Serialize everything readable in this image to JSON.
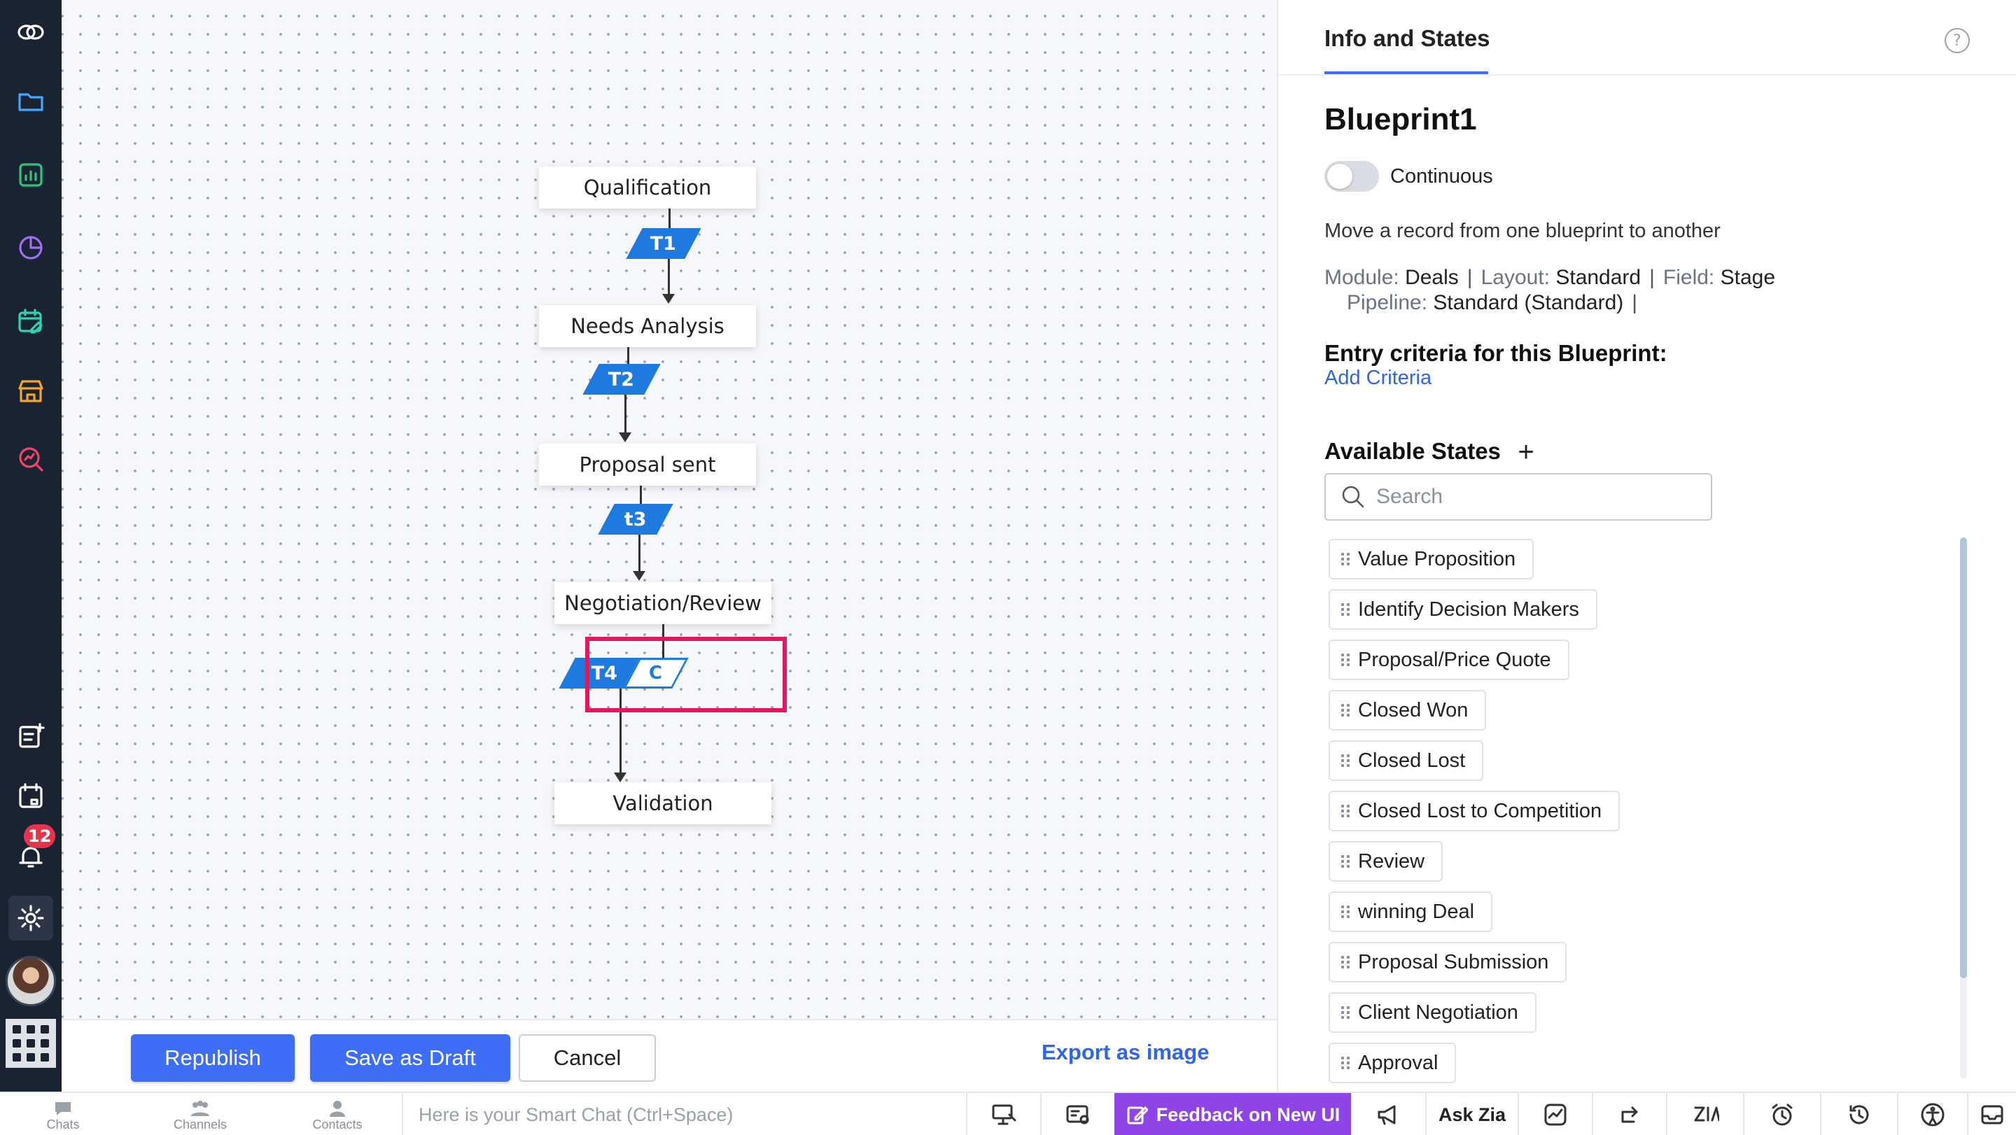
{
  "rail": {
    "icons": [
      "zoho-logo-icon",
      "folder-icon",
      "analytics-icon",
      "pie-chart-icon",
      "calendar-edit-icon",
      "marketplace-icon",
      "search-zoom-icon",
      "add-note-icon",
      "calendar-icon",
      "bell-icon",
      "gear-icon",
      "avatar",
      "apps-grid-icon"
    ],
    "notification_count": "12"
  },
  "canvas": {
    "states": [
      "Qualification",
      "Needs Analysis",
      "Proposal sent",
      "Negotiation/Review",
      "Validation"
    ],
    "transitions": [
      "T1",
      "T2",
      "t3",
      "T4"
    ],
    "condition_badge": "C",
    "colors": {
      "transition": "#1f7ae0",
      "highlight": "#e3175b"
    }
  },
  "actions": {
    "republish": "Republish",
    "save_draft": "Save as Draft",
    "cancel": "Cancel",
    "export": "Export as image"
  },
  "panel": {
    "tab": "Info and States",
    "help": "?",
    "title": "Blueprint1",
    "toggle_label": "Continuous",
    "description": "Move a record from one blueprint to another",
    "module_key": "Module:",
    "module_val": "Deals",
    "layout_key": "Layout:",
    "layout_val": "Standard",
    "field_key": "Field:",
    "field_val": "Stage",
    "pipeline_key": "Pipeline:",
    "pipeline_val": "Standard (Standard)",
    "separator": "|",
    "entry_title": "Entry criteria for this Blueprint:",
    "add_criteria": "Add Criteria",
    "available_title": "Available States",
    "add_state": "+",
    "search_placeholder": "Search",
    "available_states": [
      "Value Proposition",
      "Identify Decision Makers",
      "Proposal/Price Quote",
      "Closed Won",
      "Closed Lost",
      "Closed Lost to Competition",
      "Review",
      "winning Deal",
      "Proposal Submission",
      "Client Negotiation",
      "Approval"
    ]
  },
  "bottom_bar": {
    "chats": "Chats",
    "channels": "Channels",
    "contacts": "Contacts",
    "smart_chat": "Here is your Smart Chat (Ctrl+Space)",
    "feedback": "Feedback on New UI",
    "ask_zia": "Ask Zia"
  }
}
